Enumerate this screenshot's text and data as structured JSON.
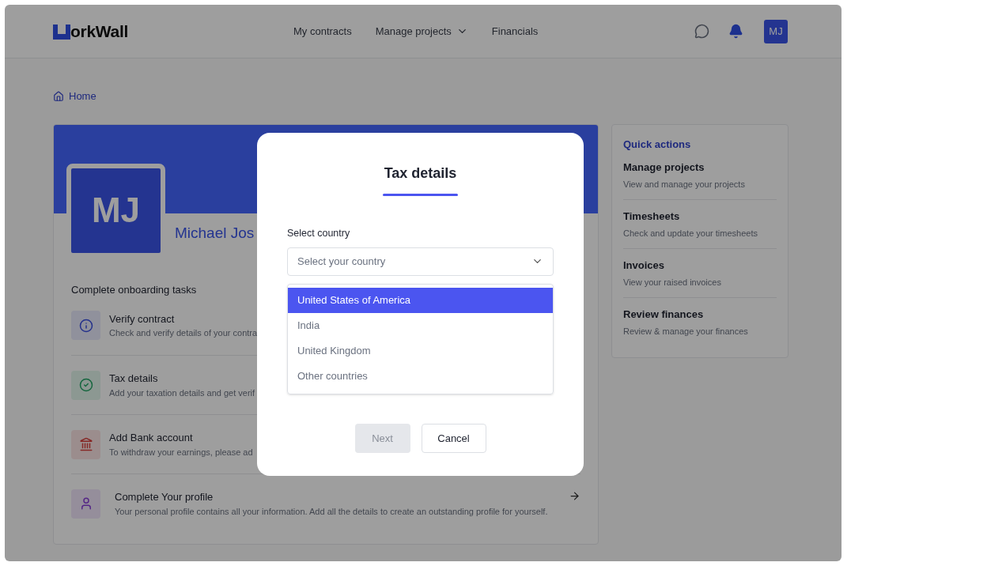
{
  "header": {
    "logo_text": "orkWall",
    "nav": [
      {
        "label": "My contracts",
        "has_dropdown": false
      },
      {
        "label": "Manage projects",
        "has_dropdown": true
      },
      {
        "label": "Financials",
        "has_dropdown": false
      }
    ],
    "avatar": "MJ"
  },
  "breadcrumb": "Home",
  "profile": {
    "initials": "MJ",
    "name": "Michael Jos"
  },
  "onboarding": {
    "title": "Complete onboarding tasks",
    "tasks": [
      {
        "kind": "info",
        "title": "Verify contract",
        "description": "Check and verify details of your contra",
        "has_arrow": false
      },
      {
        "kind": "check",
        "title": "Tax details",
        "description": "Add your taxation details and get verif",
        "has_arrow": false
      },
      {
        "kind": "bank",
        "title": "Add Bank account",
        "description": "To withdraw your earnings, please ad",
        "has_arrow": false
      },
      {
        "kind": "user",
        "title": "Complete Your profile",
        "description": "Your personal profile contains all your information. Add all the details to create an outstanding profile for yourself.",
        "has_arrow": true
      }
    ]
  },
  "quick_actions": {
    "title": "Quick actions",
    "items": [
      {
        "title": "Manage projects",
        "description": "View and manage your projects"
      },
      {
        "title": "Timesheets",
        "description": "Check and update your timesheets"
      },
      {
        "title": "Invoices",
        "description": "View your raised invoices"
      },
      {
        "title": "Review finances",
        "description": "Review & manage your finances"
      }
    ]
  },
  "modal": {
    "title": "Tax details",
    "field_label": "Select country",
    "placeholder": "Select your country",
    "options": [
      {
        "label": "United States of America",
        "selected": true
      },
      {
        "label": "India",
        "selected": false
      },
      {
        "label": "United Kingdom",
        "selected": false
      },
      {
        "label": "Other countries",
        "selected": false
      }
    ],
    "buttons": [
      {
        "label": "Next",
        "kind": "primary",
        "disabled": true
      },
      {
        "label": "Cancel",
        "kind": "secondary",
        "disabled": false
      }
    ]
  }
}
